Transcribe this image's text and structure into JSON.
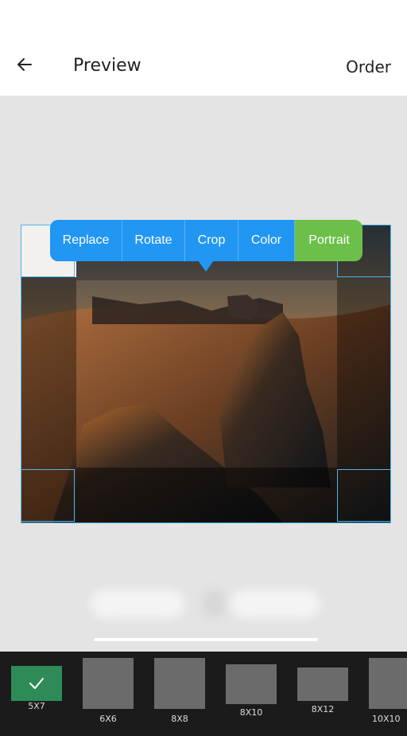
{
  "header": {
    "title": "Preview",
    "order_label": "Order",
    "back_icon": "arrow-left-icon"
  },
  "toolbar": {
    "tools": [
      {
        "label": "Replace"
      },
      {
        "label": "Rotate"
      },
      {
        "label": "Crop"
      },
      {
        "label": "Color"
      },
      {
        "label": "Portrait"
      }
    ],
    "active_color": "#2196f3",
    "highlight_color": "#6cc04a"
  },
  "photo": {
    "subject": "desert-rock-landscape",
    "frame_border_color": "#4fb3e8"
  },
  "sizes": {
    "selected": "5X7",
    "selected_icon": "check-icon",
    "accent": "#2e8b57",
    "items": [
      {
        "label": "5X7"
      },
      {
        "label": "6X6"
      },
      {
        "label": "8X8"
      },
      {
        "label": "8X10"
      },
      {
        "label": "8X12"
      },
      {
        "label": "10X10"
      }
    ]
  }
}
